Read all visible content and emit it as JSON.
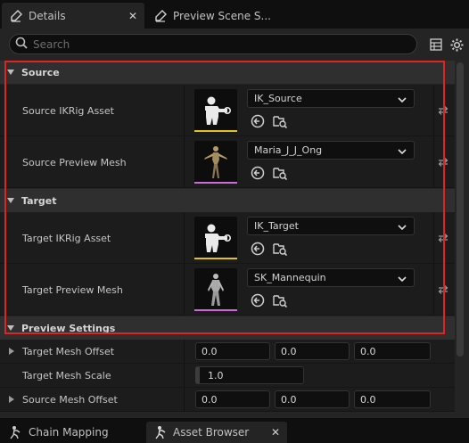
{
  "tabs": {
    "details_label": "Details",
    "details_close": "✕",
    "preview_label": "Preview Scene S..."
  },
  "search": {
    "placeholder": "Search"
  },
  "toolbar": {
    "table_icon": "table-view-icon",
    "settings_icon": "gear-icon"
  },
  "sections": {
    "source": "Source",
    "target": "Target",
    "preview": "Preview Settings"
  },
  "rows": {
    "source_ikrig": {
      "label": "Source IKRig Asset",
      "value": "IK_Source",
      "bar_color": "#e5c21a"
    },
    "source_mesh": {
      "label": "Source Preview Mesh",
      "value": "Maria_J_J_Ong",
      "bar_color": "#d06ad8"
    },
    "target_ikrig": {
      "label": "Target IKRig Asset",
      "value": "IK_Target",
      "bar_color": "#e5c21a"
    },
    "target_mesh": {
      "label": "Target Preview Mesh",
      "value": "SK_Mannequin",
      "bar_color": "#d06ad8"
    }
  },
  "preview_settings": {
    "target_mesh_offset": {
      "label": "Target Mesh Offset",
      "x": "0.0",
      "y": "0.0",
      "z": "0.0"
    },
    "target_mesh_scale": {
      "label": "Target Mesh Scale",
      "value": "1.0"
    },
    "source_mesh_offset": {
      "label": "Source Mesh Offset",
      "x": "0.0",
      "y": "0.0",
      "z": "0.0"
    }
  },
  "bottom_tabs": {
    "chain_mapping": "Chain Mapping",
    "asset_browser": "Asset Browser",
    "asset_browser_close": "✕"
  }
}
